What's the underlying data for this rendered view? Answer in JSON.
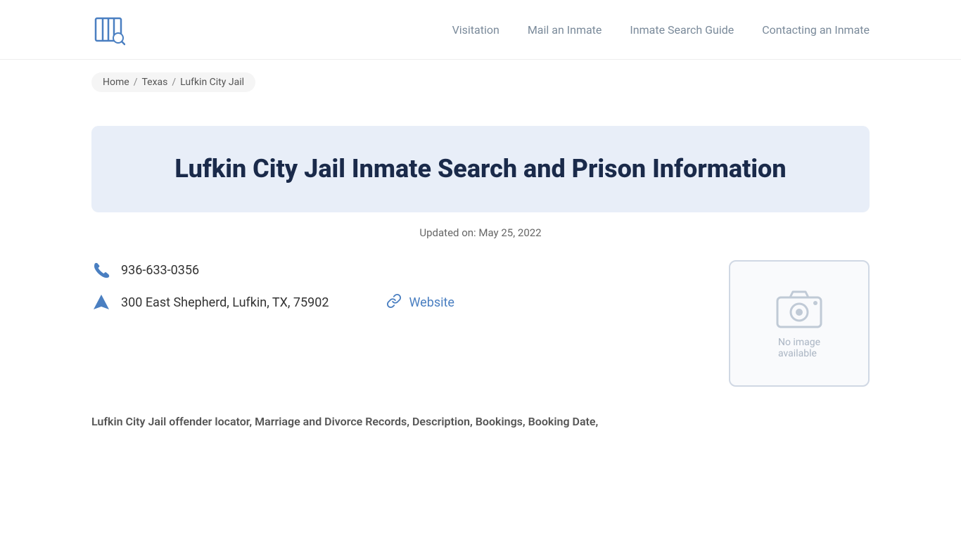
{
  "nav": {
    "links": [
      {
        "label": "Visitation",
        "href": "#"
      },
      {
        "label": "Mail an Inmate",
        "href": "#"
      },
      {
        "label": "Inmate Search Guide",
        "href": "#"
      },
      {
        "label": "Contacting an Inmate",
        "href": "#"
      }
    ]
  },
  "breadcrumb": {
    "home": "Home",
    "state": "Texas",
    "facility": "Lufkin City Jail",
    "sep": "/"
  },
  "hero": {
    "title": "Lufkin City Jail Inmate Search and Prison Information"
  },
  "updated": {
    "label": "Updated on: May 25, 2022"
  },
  "facility": {
    "phone": "936-633-0356",
    "address": "300 East Shepherd, Lufkin, TX, 75902",
    "website_label": "Website",
    "website_href": "#",
    "no_image_line1": "No image",
    "no_image_line2": "available"
  },
  "bottom": {
    "text": "Lufkin City Jail offender locator, Marriage and Divorce Records, Description, Bookings, Booking Date,"
  }
}
